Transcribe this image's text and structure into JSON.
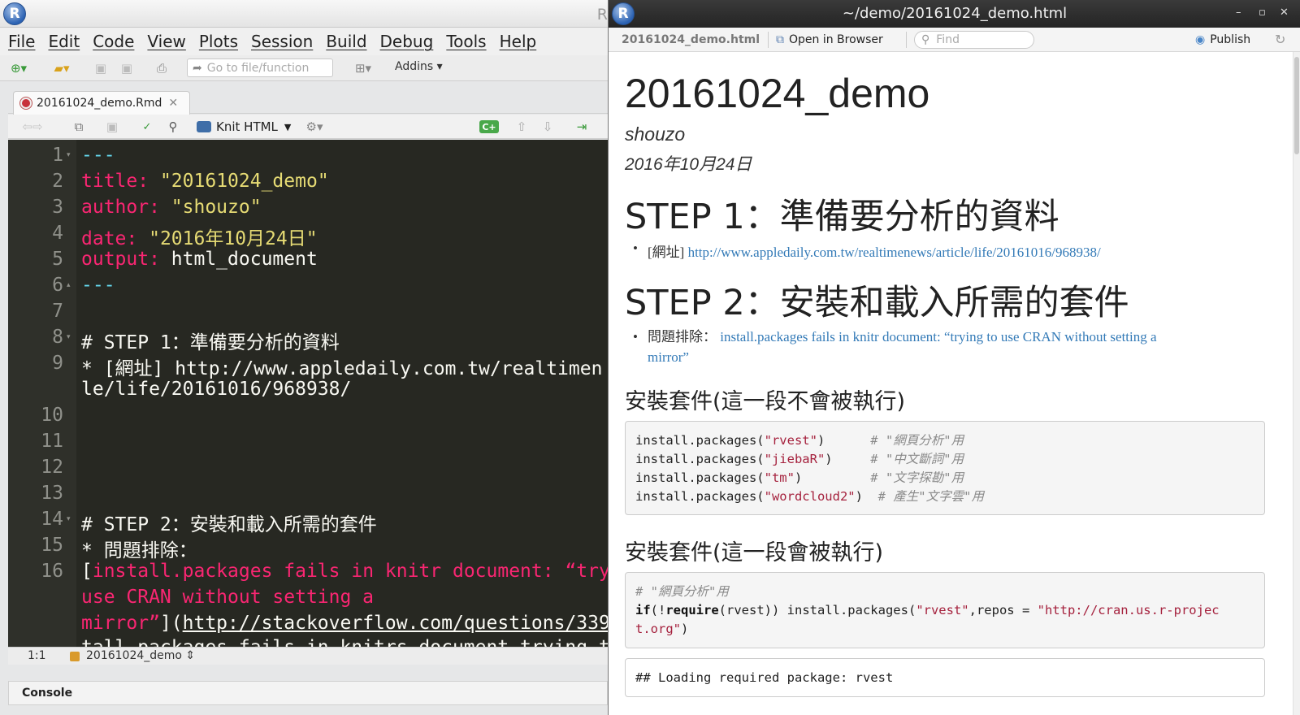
{
  "rstudio": {
    "title_fragment": "R",
    "menu": [
      "File",
      "Edit",
      "Code",
      "View",
      "Plots",
      "Session",
      "Build",
      "Debug",
      "Tools",
      "Help"
    ],
    "goto_placeholder": "Go to file/function",
    "addins_label": "Addins",
    "doc_tab": "20161024_demo.Rmd",
    "knit_label": "Knit HTML",
    "line_numbers": [
      "1",
      "2",
      "3",
      "4",
      "5",
      "6",
      "7",
      "8",
      "9",
      "10",
      "11",
      "12",
      "13",
      "14",
      "15",
      "16"
    ],
    "code": {
      "l1": "---",
      "l2_key": "title:",
      "l2_val": "\"20161024_demo\"",
      "l3_key": "author:",
      "l3_val": "\"shouzo\"",
      "l4_key": "date:",
      "l4_val": "\"2016年10月24日\"",
      "l5_key": "output:",
      "l5_val": "html_document",
      "l6": "---",
      "l8": "# STEP 1：準備要分析的資料",
      "l9a": "* [網址] http://www.appledaily.com.tw/realtimen",
      "l9b": "le/life/20161016/968938/",
      "l14": "# STEP 2：安裝和載入所需的套件",
      "l15": "* 問題排除：",
      "l16a_bracket": "[",
      "l16a": "install.packages fails in knitr document: “try",
      "l16b": "use CRAN without setting a",
      "l16c_text": "mirror”",
      "l16c_mid": "](",
      "l16c_link": "http://stackoverflow.com/questions/339",
      "l16d": "tall-packages-fails-in-knitrs-document-trying-to"
    },
    "status_pos": "1:1",
    "status_chunk": "20161024_demo",
    "console_label": "Console"
  },
  "viewer": {
    "window_title": "~/demo/20161024_demo.html",
    "file_label": "20161024_demo.html",
    "open_browser_label": "Open in Browser",
    "find_placeholder": "Find",
    "publish_label": "Publish",
    "doc_title": "20161024_demo",
    "author": "shouzo",
    "date": "2016年10月24日",
    "step1_heading": "STEP 1：準備要分析的資料",
    "step1_bullet_prefix": "[網址]",
    "step1_link": "http://www.appledaily.com.tw/realtimenews/article/life/20161016/968938/",
    "step2_heading": "STEP 2：安裝和載入所需的套件",
    "step2_bullet_prefix": "問題排除：",
    "step2_link_line1": "install.packages fails in knitr document: “trying to use CRAN without setting a",
    "step2_link_line2": "mirror”",
    "install_h_not_run": "安裝套件(這一段不會被執行)",
    "install_lines": [
      {
        "fn": "install.packages(",
        "str": "\"rvest\"",
        "close": ")      ",
        "comment": "# \"網頁分析\"用"
      },
      {
        "fn": "install.packages(",
        "str": "\"jiebaR\"",
        "close": ")     ",
        "comment": "# \"中文斷詞\"用"
      },
      {
        "fn": "install.packages(",
        "str": "\"tm\"",
        "close": ")         ",
        "comment": "# \"文字探勘\"用"
      },
      {
        "fn": "install.packages(",
        "str": "\"wordcloud2\"",
        "close": ")  ",
        "comment": "# 產生\"文字雲\"用"
      }
    ],
    "install_h_run": "安裝套件(這一段會被執行)",
    "run_comment": "# \"網頁分析\"用",
    "run_kw_if": "if",
    "run_kw_require": "require",
    "run_line_a": "(!",
    "run_line_b": "(rvest)) install.packages(",
    "run_str_pkg": "\"rvest\"",
    "run_line_c": ",repos = ",
    "run_str_repo1": "\"http://cran.us.r-projec",
    "run_str_repo2": "t.org\"",
    "run_close": ")",
    "output_line": "## Loading required package: rvest"
  }
}
